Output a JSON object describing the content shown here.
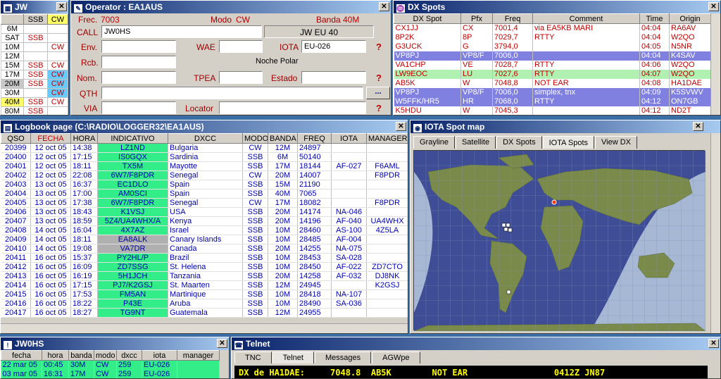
{
  "band_win": {
    "title": "JW",
    "head": [
      "",
      "SSB",
      "CW"
    ],
    "rows": [
      [
        "6M",
        "",
        ""
      ],
      [
        "SAT",
        "SSB",
        ""
      ],
      [
        "10M",
        "",
        "CW"
      ],
      [
        "12M",
        "",
        ""
      ],
      [
        "15M",
        "SSB",
        "CW"
      ],
      [
        "17M",
        "SSB",
        "CW"
      ],
      [
        "20M",
        "SSB",
        "CW"
      ],
      [
        "30M",
        "",
        "CW"
      ],
      [
        "40M",
        "SSB",
        "CW"
      ],
      [
        "80M",
        "SSB",
        ""
      ]
    ]
  },
  "operator": {
    "title": "Operator : EA1AUS",
    "frec_label": "Frec.",
    "frec_value": "7003",
    "modo_label": "Modo",
    "modo_value": "CW",
    "banda_label": "Banda",
    "banda_value": "40M",
    "call_label": "CALL",
    "call_value": "JW0HS",
    "info_box": "JW  EU  40",
    "env_label": "Env.",
    "wae_label": "WAE",
    "iota_label": "IOTA",
    "iota_value": "EU-026",
    "rcb_label": "Rcb.",
    "region": "Noche Polar",
    "nom_label": "Nom.",
    "tpea_label": "TPEA",
    "estado_label": "Estado",
    "qth_label": "QTH",
    "qth_btn": "...",
    "via_label": "VIA",
    "locator_label": "Locator",
    "qmark": "?"
  },
  "dxspots": {
    "title": "DX Spots",
    "cols": [
      "DX Spot",
      "Pfx",
      "Freq",
      "Comment",
      "Time",
      "Origin"
    ],
    "rows": [
      {
        "c": [
          "CX1JJ",
          "CX",
          "7001,4",
          "via EA5KB MARI",
          "04:04",
          "RA6AV"
        ],
        "bg": "#ffffff"
      },
      {
        "c": [
          "8P2K",
          "8P",
          "7029,7",
          "RTTY",
          "04:04",
          "W2QO"
        ],
        "bg": "#ffffff"
      },
      {
        "c": [
          "G3UCK",
          "G",
          "3794,0",
          "",
          "04:05",
          "N5NR"
        ],
        "bg": "#ffffff"
      },
      {
        "c": [
          "VP8PJ",
          "VP8/F",
          "7006,0",
          "",
          "04:04",
          "K4SAV"
        ],
        "bg": "#8080e0"
      },
      {
        "c": [
          "VA1CHP",
          "VE",
          "7028,7",
          "RTTY",
          "04:06",
          "W2QO"
        ],
        "bg": "#ffffff"
      },
      {
        "c": [
          "LW9EOC",
          "LU",
          "7027,6",
          "RTTY",
          "04:07",
          "W2QO"
        ],
        "bg": "#b0f0b0"
      },
      {
        "c": [
          "AB5K",
          "W",
          "7048,8",
          "NOT EAR",
          "04:08",
          "HA1DAE"
        ],
        "bg": "#ffffff"
      },
      {
        "c": [
          "VP8PJ",
          "VP8/F",
          "7006,0",
          "simplex, tnx",
          "04:09",
          "K5SVWV"
        ],
        "bg": "#8080e0"
      },
      {
        "c": [
          "W5FFK/HR5",
          "HR",
          "7068,0",
          "RTTY",
          "04:12",
          "ON7GB"
        ],
        "bg": "#8080e0"
      },
      {
        "c": [
          "K5HDU",
          "W",
          "7045,3",
          "",
          "04:12",
          "ND2T"
        ],
        "bg": "#ffffff"
      }
    ]
  },
  "logbook": {
    "title": "Logbook page (C:\\RADIO\\LOGGER32\\EA1AUS)",
    "cols": [
      "QSO",
      "FECHA",
      "HORA",
      "INDICATIVO",
      "DXCC",
      "MODO",
      "BANDA",
      "FREQ",
      "IOTA",
      "MANAGER"
    ],
    "rows": [
      [
        "20399",
        "12 oct 05",
        "14:38",
        "LZ1ND",
        "Bulgaria",
        "CW",
        "12M",
        "24897",
        "",
        ""
      ],
      [
        "20400",
        "12 oct 05",
        "17:15",
        "IS0GQX",
        "Sardinia",
        "SSB",
        "6M",
        "50140",
        "",
        ""
      ],
      [
        "20401",
        "12 oct 05",
        "18:11",
        "TX5M",
        "Mayotte",
        "SSB",
        "17M",
        "18144",
        "AF-027",
        "F6AML"
      ],
      [
        "20402",
        "12 oct 05",
        "22:08",
        "6W7/F8PDR",
        "Senegal",
        "CW",
        "20M",
        "14007",
        "",
        "F8PDR"
      ],
      [
        "20403",
        "13 oct 05",
        "16:37",
        "EC1DLO",
        "Spain",
        "SSB",
        "15M",
        "21190",
        "",
        ""
      ],
      [
        "20404",
        "13 oct 05",
        "17:00",
        "AM0SCI",
        "Spain",
        "SSB",
        "40M",
        "7065",
        "",
        ""
      ],
      [
        "20405",
        "13 oct 05",
        "17:38",
        "6W7/F8PDR",
        "Senegal",
        "CW",
        "17M",
        "18082",
        "",
        "F8PDR"
      ],
      [
        "20406",
        "13 oct 05",
        "18:43",
        "K1VSJ",
        "USA",
        "SSB",
        "20M",
        "14174",
        "NA-046",
        ""
      ],
      [
        "20407",
        "13 oct 05",
        "18:59",
        "5Z4/UA4WHX/A",
        "Kenya",
        "SSB",
        "20M",
        "14196",
        "AF-040",
        "UA4WHX"
      ],
      [
        "20408",
        "14 oct 05",
        "16:04",
        "4X7AZ",
        "Israel",
        "SSB",
        "10M",
        "28460",
        "AS-100",
        "4Z5LA"
      ],
      [
        "20409",
        "14 oct 05",
        "18:11",
        "EA8ALK",
        "Canary Islands",
        "SSB",
        "10M",
        "28485",
        "AF-004",
        ""
      ],
      [
        "20410",
        "14 oct 05",
        "19:08",
        "VA7DR",
        "Canada",
        "SSB",
        "20M",
        "14255",
        "NA-075",
        ""
      ],
      [
        "20411",
        "16 oct 05",
        "15:37",
        "PY2HL/P",
        "Brazil",
        "SSB",
        "10M",
        "28453",
        "SA-028",
        ""
      ],
      [
        "20412",
        "16 oct 05",
        "16:09",
        "ZD7SSG",
        "St. Helena",
        "SSB",
        "10M",
        "28450",
        "AF-022",
        "ZD7CTO"
      ],
      [
        "20413",
        "16 oct 05",
        "16:19",
        "5H1JCH",
        "Tanzania",
        "SSB",
        "20M",
        "14258",
        "AF-032",
        "DJ8NK"
      ],
      [
        "20414",
        "16 oct 05",
        "17:15",
        "PJ7/K2GSJ",
        "St. Maarten",
        "SSB",
        "12M",
        "24945",
        "",
        "K2GSJ"
      ],
      [
        "20415",
        "16 oct 05",
        "17:53",
        "FM5AN",
        "Martinique",
        "SSB",
        "10M",
        "28418",
        "NA-107",
        ""
      ],
      [
        "20416",
        "16 oct 05",
        "18:22",
        "P43E",
        "Aruba",
        "SSB",
        "10M",
        "28490",
        "SA-036",
        ""
      ],
      [
        "20417",
        "16 oct 05",
        "18:27",
        "TG9NT",
        "Guatemala",
        "SSB",
        "12M",
        "24955",
        "",
        ""
      ]
    ]
  },
  "iota_map": {
    "title": "IOTA Spot map",
    "tabs": [
      "Grayline",
      "Satellite",
      "DX Spots",
      "IOTA Spots",
      "View DX"
    ],
    "active_tab": "IOTA Spots"
  },
  "prev_qso": {
    "title": "JW0HS",
    "cols": [
      "fecha",
      "hora",
      "banda",
      "modo",
      "dxcc",
      "iota",
      "manager"
    ],
    "rows": [
      [
        "22 mar 05",
        "00:45",
        "30M",
        "CW",
        "259",
        "EU-026",
        ""
      ],
      [
        "03 mar 05",
        "16:31",
        "17M",
        "CW",
        "259",
        "EU-026",
        ""
      ]
    ]
  },
  "telnet": {
    "title": "Telnet",
    "tabs": [
      "TNC",
      "Telnet",
      "Messages",
      "AGWpe"
    ],
    "active_tab": "Telnet",
    "line": "DX de HA1DAE:     7048.8  AB5K        NOT EAR                 0412Z JN87"
  },
  "colors": {
    "title_bar": "#0a246a",
    "callsign_cell": "#33ee88",
    "mode_cell": "#b0b0b0",
    "highlight_cyan": "#66ccff",
    "highlight_yellow": "#ffff66",
    "highlight_purple": "#8080e0"
  }
}
